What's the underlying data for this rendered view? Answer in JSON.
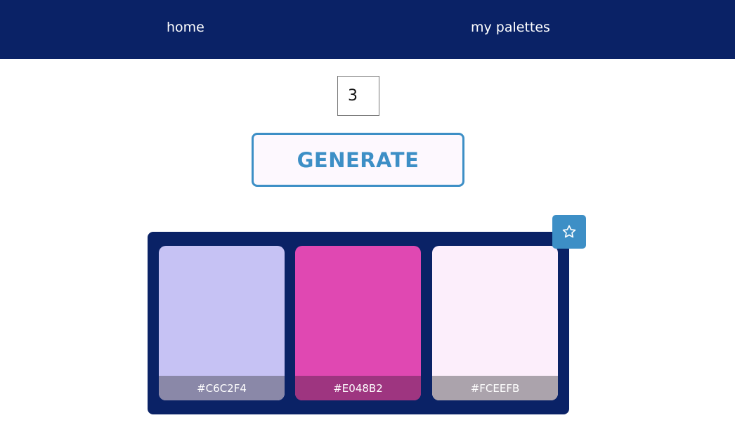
{
  "nav": {
    "home_label": "home",
    "palettes_label": "my palettes"
  },
  "controls": {
    "count_value": "3",
    "generate_label": "GENERATE"
  },
  "favorite_icon": "star-icon",
  "palette": {
    "swatches": [
      {
        "hex": "#C6C2F4",
        "color": "#c6c2f4",
        "label_bg": "#8a88a8"
      },
      {
        "hex": "#E048B2",
        "color": "#e048b2",
        "label_bg": "#9e3580"
      },
      {
        "hex": "#FCEEFB",
        "color": "#fceefb",
        "label_bg": "#aba3ac"
      }
    ]
  },
  "colors": {
    "nav_bg": "#0a2266",
    "accent": "#3d8fc6",
    "button_bg": "#fdf8fe"
  }
}
